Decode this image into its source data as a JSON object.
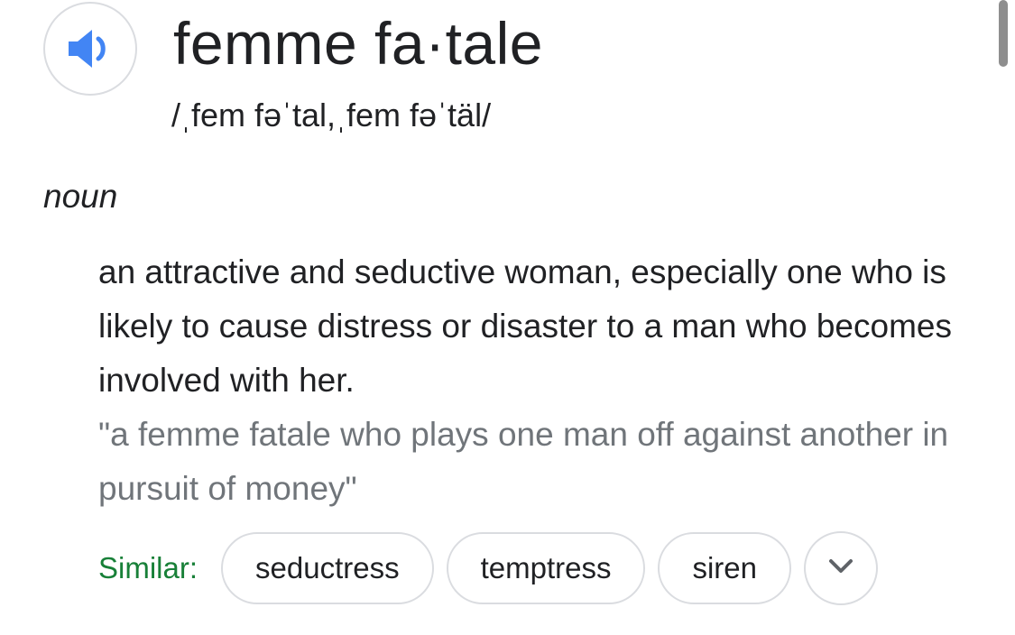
{
  "entry": {
    "headword": "femme fa·tale",
    "phonetic": "/ˌfem fəˈtal,ˌfem fəˈtäl/",
    "part_of_speech": "noun"
  },
  "sense": {
    "definition": "an attractive and seductive woman, especially one who is likely to cause distress or disaster to a man who becomes involved with her.",
    "example": "\"a femme fatale who plays one man off against another in pursuit of money\""
  },
  "similar": {
    "label": "Similar:",
    "words": [
      "seductress",
      "temptress",
      "siren"
    ]
  },
  "icons": {
    "pronounce": "speaker-icon",
    "expand": "chevron-down-icon"
  },
  "colors": {
    "speaker_blue": "#4285f4",
    "similar_green": "#188038",
    "example_gray": "#70757a",
    "chip_border": "#dadce0"
  }
}
